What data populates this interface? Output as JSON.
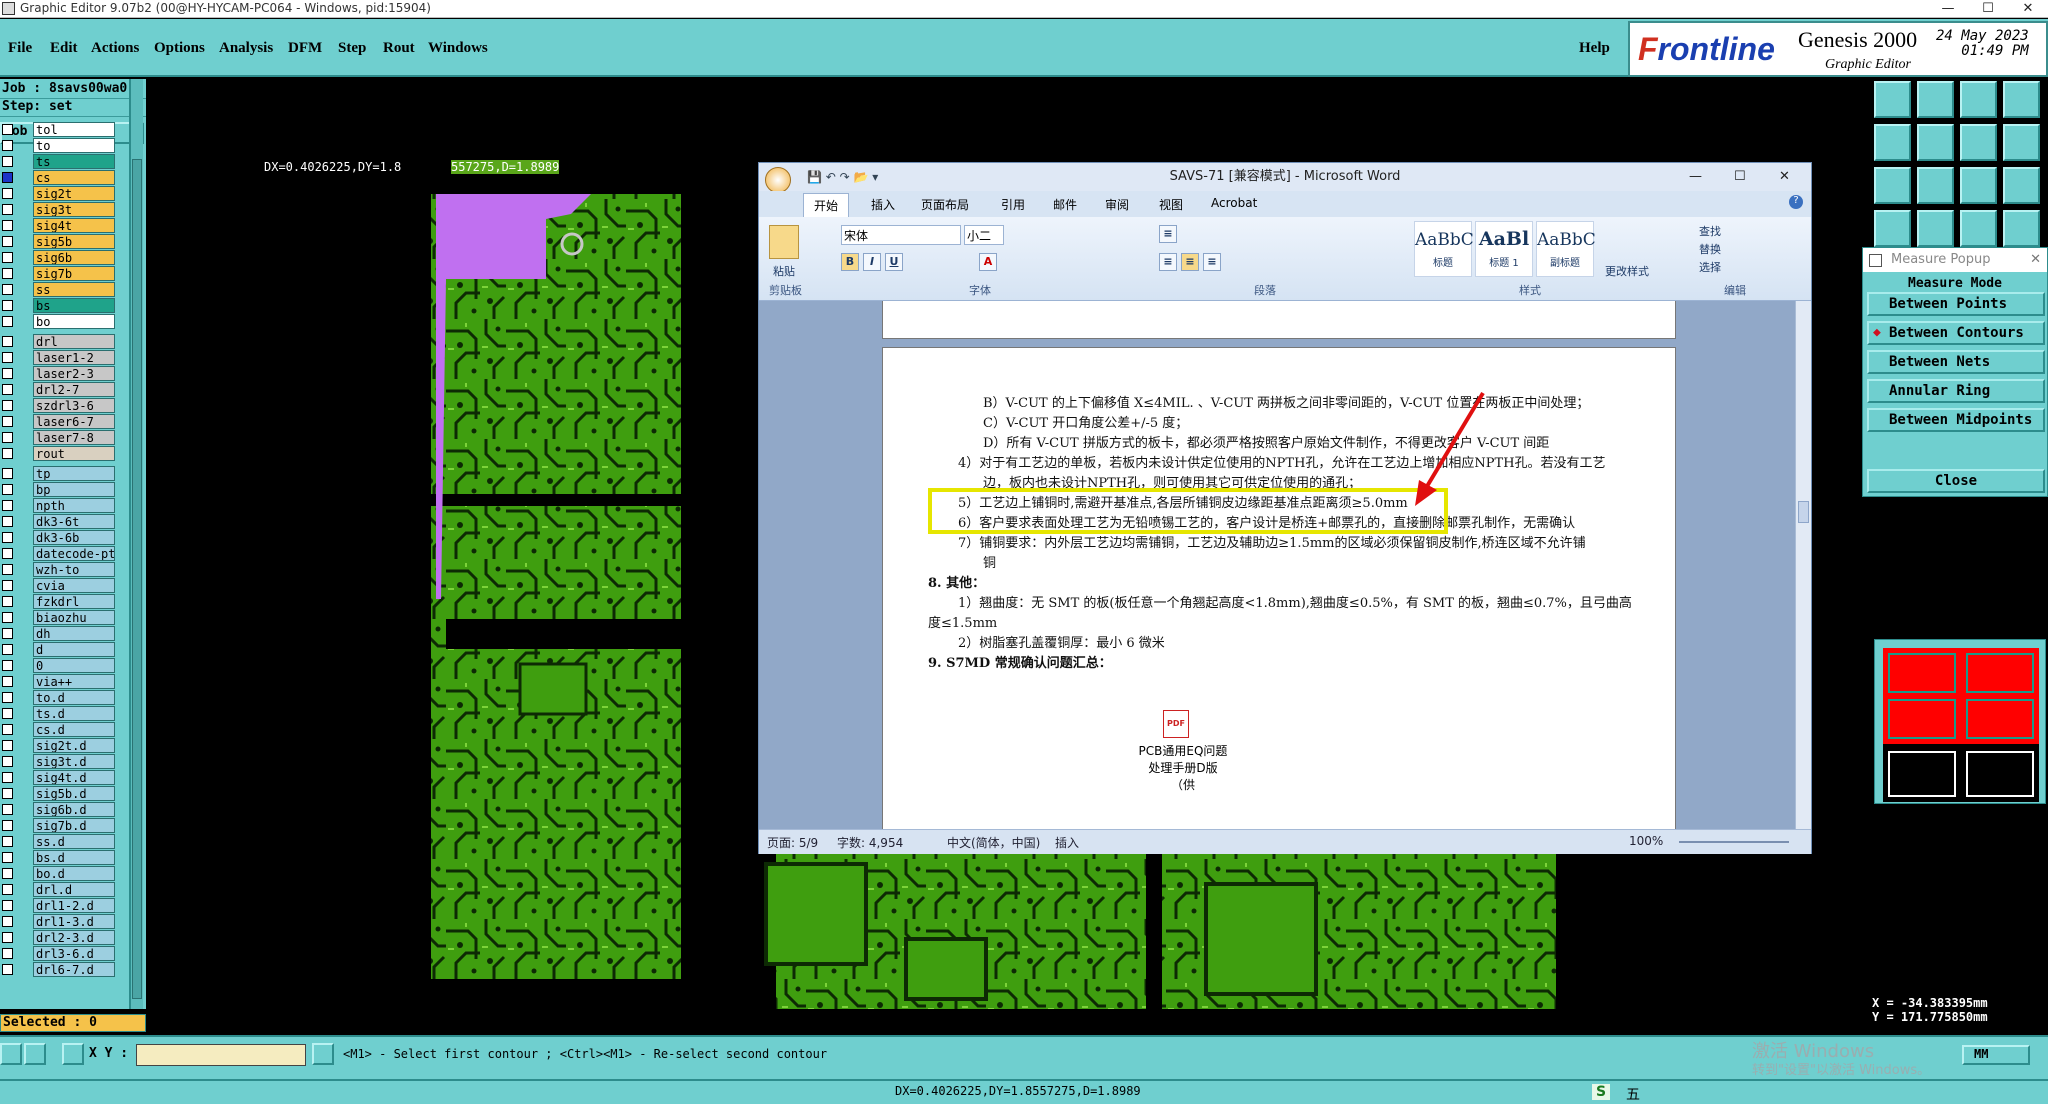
{
  "window": {
    "title": "Graphic Editor 9.07b2 (00@HY-HYCAM-PC064 - Windows, pid:15904)"
  },
  "menu": {
    "items": [
      "File",
      "Edit",
      "Actions",
      "Options",
      "Analysis",
      "DFM",
      "Step",
      "Rout",
      "Windows"
    ],
    "help": "Help"
  },
  "brand": {
    "logo": "Frontline",
    "product": "Genesis 2000",
    "subtitle": "Graphic Editor",
    "date": "24 May 2023",
    "time": "01:49 PM"
  },
  "job": {
    "job_label": "Job : 8savs00wa0",
    "step_label": "Step: set",
    "matrix_label": "Job Matrix ...",
    "selected": "Selected : 0"
  },
  "layers": [
    {
      "name": "tol",
      "color": "#ffffff"
    },
    {
      "name": "to",
      "color": "#ffffff"
    },
    {
      "name": "ts",
      "color": "#1fa38a"
    },
    {
      "name": "cs",
      "color": "#f5c24a",
      "sel": true
    },
    {
      "name": "sig2t",
      "color": "#f5c24a"
    },
    {
      "name": "sig3t",
      "color": "#f5c24a"
    },
    {
      "name": "sig4t",
      "color": "#f5c24a"
    },
    {
      "name": "sig5b",
      "color": "#f5c24a"
    },
    {
      "name": "sig6b",
      "color": "#f5c24a"
    },
    {
      "name": "sig7b",
      "color": "#f5c24a"
    },
    {
      "name": "ss",
      "color": "#f5c24a"
    },
    {
      "name": "bs",
      "color": "#1fa38a"
    },
    {
      "name": "bo",
      "color": "#ffffff"
    },
    {
      "name": "drl",
      "color": "#c7c7c7"
    },
    {
      "name": "laser1-2",
      "color": "#c7c7c7"
    },
    {
      "name": "laser2-3",
      "color": "#c7c7c7"
    },
    {
      "name": "drl2-7",
      "color": "#c7c7c7"
    },
    {
      "name": "szdrl3-6",
      "color": "#c7c7c7"
    },
    {
      "name": "laser6-7",
      "color": "#c7c7c7"
    },
    {
      "name": "laser7-8",
      "color": "#c7c7c7"
    },
    {
      "name": "rout",
      "color": "#d9d0c0"
    },
    {
      "name": "tp",
      "color": "#9ccfe0"
    },
    {
      "name": "bp",
      "color": "#9ccfe0"
    },
    {
      "name": "npth",
      "color": "#9ccfe0"
    },
    {
      "name": "dk3-6t",
      "color": "#9ccfe0"
    },
    {
      "name": "dk3-6b",
      "color": "#9ccfe0"
    },
    {
      "name": "datecode-pt",
      "color": "#9ccfe0"
    },
    {
      "name": "wzh-to",
      "color": "#9ccfe0"
    },
    {
      "name": "cvia",
      "color": "#9ccfe0"
    },
    {
      "name": "fzkdrl",
      "color": "#9ccfe0"
    },
    {
      "name": "biaozhu",
      "color": "#9ccfe0"
    },
    {
      "name": "dh",
      "color": "#9ccfe0"
    },
    {
      "name": "d",
      "color": "#9ccfe0"
    },
    {
      "name": "0",
      "color": "#9ccfe0"
    },
    {
      "name": "via++",
      "color": "#9ccfe0"
    },
    {
      "name": "to.d",
      "color": "#9ccfe0"
    },
    {
      "name": "ts.d",
      "color": "#9ccfe0"
    },
    {
      "name": "cs.d",
      "color": "#9ccfe0"
    },
    {
      "name": "sig2t.d",
      "color": "#9ccfe0"
    },
    {
      "name": "sig3t.d",
      "color": "#9ccfe0"
    },
    {
      "name": "sig4t.d",
      "color": "#9ccfe0"
    },
    {
      "name": "sig5b.d",
      "color": "#9ccfe0"
    },
    {
      "name": "sig6b.d",
      "color": "#9ccfe0"
    },
    {
      "name": "sig7b.d",
      "color": "#9ccfe0"
    },
    {
      "name": "ss.d",
      "color": "#9ccfe0"
    },
    {
      "name": "bs.d",
      "color": "#9ccfe0"
    },
    {
      "name": "bo.d",
      "color": "#9ccfe0"
    },
    {
      "name": "drl.d",
      "color": "#9ccfe0"
    },
    {
      "name": "drl1-2.d",
      "color": "#9ccfe0"
    },
    {
      "name": "drl1-3.d",
      "color": "#9ccfe0"
    },
    {
      "name": "drl2-3.d",
      "color": "#9ccfe0"
    },
    {
      "name": "drl3-6.d",
      "color": "#9ccfe0"
    },
    {
      "name": "drl6-7.d",
      "color": "#9ccfe0"
    }
  ],
  "canvas": {
    "readout_left": "DX=0.4026225,DY=1.8",
    "readout_right": "557275,D=1.8989"
  },
  "measure": {
    "title": "Measure Popup",
    "mode": "Measure Mode",
    "buttons": [
      "Between Points",
      "Between Contours",
      "Between Nets",
      "Annular Ring",
      "Between Midpoints"
    ],
    "close": "Close",
    "coord_x": "X = -34.383395mm",
    "coord_y": "Y = 171.775850mm",
    "units": "MM"
  },
  "bottom": {
    "xy_label": "X Y :",
    "xy_value": "",
    "prompt": "<M1> - Select first contour ; <Ctrl><M1> - Re-select second contour",
    "readout": "DX=0.4026225,DY=1.8557275,D=1.8989",
    "activate1": "激活 Windows",
    "activate2": "转到\"设置\"以激活 Windows。"
  },
  "word": {
    "title": "SAVS-71 [兼容模式] - Microsoft Word",
    "tabs": [
      "开始",
      "插入",
      "页面布局",
      "引用",
      "邮件",
      "审阅",
      "视图",
      "Acrobat"
    ],
    "font_name": "宋体",
    "font_size": "小二",
    "groups": [
      "剪贴板",
      "字体",
      "段落",
      "样式",
      "编辑"
    ],
    "paste": "粘贴",
    "styles": [
      {
        "sample": "AaBbC",
        "name": "标题"
      },
      {
        "sample": "AaBl",
        "name": "标题 1"
      },
      {
        "sample": "AaBbC",
        "name": "副标题"
      }
    ],
    "change_styles": "更改样式",
    "edit": [
      "查找",
      "替换",
      "选择"
    ],
    "lines": [
      "B）V-CUT 的上下偏移值 X≤4MIL. 、V-CUT 两拼板之间非零间距的，V-CUT 位置在两板正中间处理；",
      "C）V-CUT 开口角度公差+/-5 度；",
      "D）所有 V-CUT 拼版方式的板卡，都必须严格按照客户原始文件制作，不得更改客户 V-CUT 间距",
      "4）对于有工艺边的单板，若板内未设计供定位使用的NPTH孔，允许在工艺边上增加相应NPTH孔。若没有工艺",
      "边，板内也未设计NPTH孔，则可使用其它可供定位使用的通孔；",
      "5）工艺边上铺铜时,需避开基准点,各层所铺铜皮边缘距基准点距离须≥5.0mm",
      "6）客户要求表面处理工艺为无铅喷锡工艺的，客户设计是桥连+邮票孔的，直接删除邮票孔制作，无需确认",
      "7）铺铜要求：内外层工艺边均需铺铜，工艺边及辅助边≥1.5mm的区域必须保留铜皮制作,桥连区域不允许铺",
      "铜",
      "8.   其他：",
      "1）翘曲度：无 SMT 的板(板任意一个角翘起高度<1.8mm),翘曲度≤0.5%，有 SMT 的板，翘曲≤0.7%，且弓曲高",
      "度≤1.5mm",
      "2）树脂塞孔盖覆铜厚：最小 6 微米",
      "9.   S7MD 常规确认问题汇总："
    ],
    "attachment": [
      "PCB通用EQ问题",
      "处理手册D版（供"
    ],
    "status": {
      "page": "页面: 5/9",
      "words": "字数: 4,954",
      "lang": "中文(简体，中国)",
      "mode": "插入",
      "zoom": "100%"
    }
  },
  "taskbar": {
    "ime": "五"
  }
}
